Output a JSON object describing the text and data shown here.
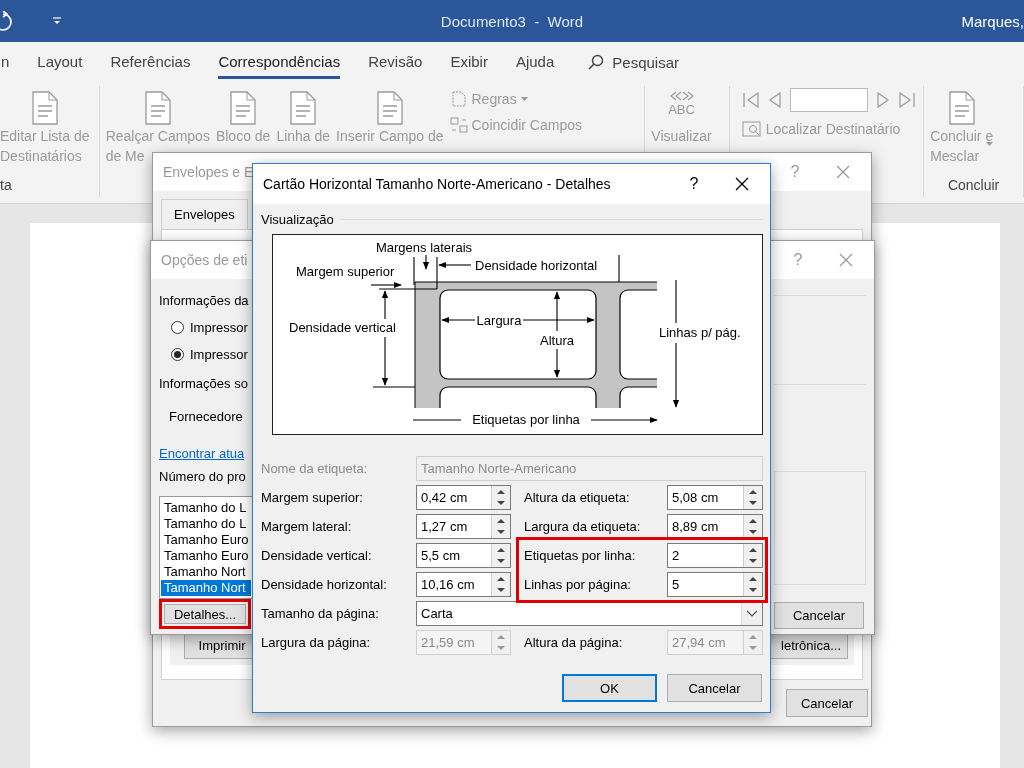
{
  "title_bar": {
    "title": "Documento3  -  Word",
    "user": "Marques,"
  },
  "ribbon": {
    "tabs": [
      {
        "label": "n",
        "selected": false
      },
      {
        "label": "Layout",
        "selected": false
      },
      {
        "label": "Referências",
        "selected": false
      },
      {
        "label": "Correspondências",
        "selected": true
      },
      {
        "label": "Revisão",
        "selected": false
      },
      {
        "label": "Exibir",
        "selected": false
      },
      {
        "label": "Ajuda",
        "selected": false
      }
    ],
    "search": "Pesquisar",
    "groups": [
      {
        "label": "ta",
        "commands": [
          {
            "kind": "large",
            "lines": [
              "Editar Lista de",
              "Destinatários"
            ],
            "disabled": true
          }
        ]
      },
      {
        "commands": [
          {
            "kind": "large",
            "lines": [
              "Realçar Campos",
              "de Me"
            ],
            "disabled": true
          },
          {
            "kind": "large",
            "lines": [
              "Bloco de"
            ],
            "disabled": true
          },
          {
            "kind": "large",
            "lines": [
              "Linha de"
            ],
            "disabled": true
          },
          {
            "kind": "large",
            "lines": [
              "Inserir Campo de"
            ],
            "disabled": true
          },
          {
            "kind": "stack",
            "items": [
              {
                "label": "Regras",
                "dropdown": true
              },
              {
                "label": "Coincidir Campos",
                "dropdown": false
              }
            ],
            "disabled": true
          }
        ]
      },
      {
        "commands": [
          {
            "kind": "preview",
            "badge": "ABC",
            "lines": [
              "Visualizar"
            ],
            "disabled": true
          }
        ]
      },
      {
        "commands": [
          {
            "kind": "nav",
            "items": [
              {
                "label": "Localizar Destinatário",
                "dropdown": false
              }
            ],
            "disabled": true
          }
        ]
      },
      {
        "label": "Concluir",
        "commands": [
          {
            "kind": "large",
            "lines": [
              "Concluir e",
              "Mesclar"
            ],
            "dropdown": true,
            "disabled": true
          }
        ]
      }
    ]
  },
  "envelopes_dialog": {
    "title": "Envelopes e E",
    "help": "?",
    "tabs": [
      {
        "label": "Envelopes",
        "selected": false
      }
    ],
    "buttons": [
      {
        "label": "Imprimir"
      },
      {
        "label": "letrônica..."
      }
    ],
    "cancel": "Cancelar"
  },
  "options_dialog": {
    "title": "Opções de eti",
    "help": "?",
    "items": [
      {
        "kind": "heading",
        "text": "Informações da"
      },
      {
        "kind": "radio",
        "text": "Impressor",
        "selected": false
      },
      {
        "kind": "radio",
        "text": "Impressor",
        "selected": true
      },
      {
        "kind": "heading",
        "text": "Informações so"
      },
      {
        "kind": "label",
        "text": "Fornecedore"
      },
      {
        "kind": "link",
        "text": "Encontrar atua"
      },
      {
        "kind": "heading",
        "text": "Número do pro"
      }
    ],
    "list": [
      {
        "text": "Tamanho do L",
        "selected": false
      },
      {
        "text": "Tamanho do L",
        "selected": false
      },
      {
        "text": "Tamanho Euro",
        "selected": false
      },
      {
        "text": "Tamanho Euro",
        "selected": false
      },
      {
        "text": "Tamanho Nort",
        "selected": false
      },
      {
        "text": "Tamanho Nort",
        "selected": true
      }
    ],
    "details_button": {
      "label": "Detalhes...",
      "highlighted": true
    },
    "cancel": "Cancelar"
  },
  "details_dialog": {
    "title": "Cartão Horizontal Tamanho Norte-Americano - Detalhes",
    "help": "?",
    "preview_heading": "Visualização",
    "diagram_labels": [
      "Margens laterais",
      "Margem superior",
      "Densidade horizontal",
      "Densidade vertical",
      "Largura",
      "Altura",
      "Linhas p/ pág.",
      "Etiquetas por linha"
    ],
    "name_field": {
      "label": "Nome da etiqueta:",
      "value": "Tamanho Norte-Americano",
      "disabled": true
    },
    "fields": [
      {
        "label": "Margem superior:",
        "value": "0,42 cm",
        "disabled": false
      },
      {
        "label": "Altura da etiqueta:",
        "value": "5,08 cm",
        "disabled": false
      },
      {
        "label": "Margem lateral:",
        "value": "1,27 cm",
        "disabled": false
      },
      {
        "label": "Largura da etiqueta:",
        "value": "8,89 cm",
        "disabled": false
      },
      {
        "label": "Densidade vertical:",
        "value": "5,5 cm",
        "disabled": false
      },
      {
        "label": "Etiquetas por linha:",
        "value": "2",
        "disabled": false,
        "highlighted": true
      },
      {
        "label": "Densidade horizontal:",
        "value": "10,16 cm",
        "disabled": false
      },
      {
        "label": "Linhas por página:",
        "value": "5",
        "disabled": false,
        "highlighted": true
      }
    ],
    "page_size": {
      "label": "Tamanho da página:",
      "value": "Carta"
    },
    "page_fields": [
      {
        "label": "Largura da página:",
        "value": "21,59 cm",
        "disabled": true
      },
      {
        "label": "Altura da página:",
        "value": "27,94 cm",
        "disabled": true
      }
    ],
    "buttons": [
      {
        "label": "OK",
        "default": true
      },
      {
        "label": "Cancelar",
        "default": false
      }
    ]
  }
}
